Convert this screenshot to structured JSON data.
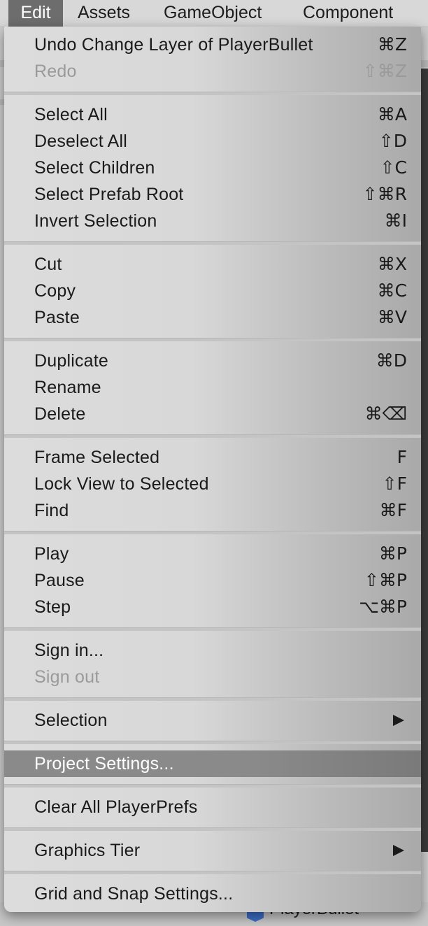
{
  "menubar": {
    "items": [
      {
        "label": "Edit"
      },
      {
        "label": "Assets"
      },
      {
        "label": "GameObject"
      },
      {
        "label": "Component"
      }
    ]
  },
  "edit_menu": {
    "items": [
      {
        "label": "Undo Change Layer of PlayerBullet",
        "shortcut": "⌘Z"
      },
      {
        "label": "Redo",
        "shortcut": "⇧⌘Z",
        "disabled": true
      },
      {
        "label": "Select All",
        "shortcut": "⌘A"
      },
      {
        "label": "Deselect All",
        "shortcut": "⇧D"
      },
      {
        "label": "Select Children",
        "shortcut": "⇧C"
      },
      {
        "label": "Select Prefab Root",
        "shortcut": "⇧⌘R"
      },
      {
        "label": "Invert Selection",
        "shortcut": "⌘I"
      },
      {
        "label": "Cut",
        "shortcut": "⌘X"
      },
      {
        "label": "Copy",
        "shortcut": "⌘C"
      },
      {
        "label": "Paste",
        "shortcut": "⌘V"
      },
      {
        "label": "Duplicate",
        "shortcut": "⌘D"
      },
      {
        "label": "Rename",
        "shortcut": ""
      },
      {
        "label": "Delete",
        "shortcut": "⌘⌫"
      },
      {
        "label": "Frame Selected",
        "shortcut": "F"
      },
      {
        "label": "Lock View to Selected",
        "shortcut": "⇧F"
      },
      {
        "label": "Find",
        "shortcut": "⌘F"
      },
      {
        "label": "Play",
        "shortcut": "⌘P"
      },
      {
        "label": "Pause",
        "shortcut": "⇧⌘P"
      },
      {
        "label": "Step",
        "shortcut": "⌥⌘P"
      },
      {
        "label": "Sign in...",
        "shortcut": ""
      },
      {
        "label": "Sign out",
        "shortcut": "",
        "disabled": true
      },
      {
        "label": "Selection",
        "submenu": true
      },
      {
        "label": "Project Settings...",
        "highlighted": true
      },
      {
        "label": "Clear All PlayerPrefs"
      },
      {
        "label": "Graphics Tier",
        "submenu": true
      },
      {
        "label": "Grid and Snap Settings..."
      }
    ]
  },
  "background": {
    "hierarchy_item": "PlayerBullet"
  },
  "colors": {
    "menu_bg": "#d8d8d8",
    "highlight": "#8a8a8a",
    "active_menubar": "#6d6d6d",
    "disabled_text": "#9a9a9a"
  }
}
